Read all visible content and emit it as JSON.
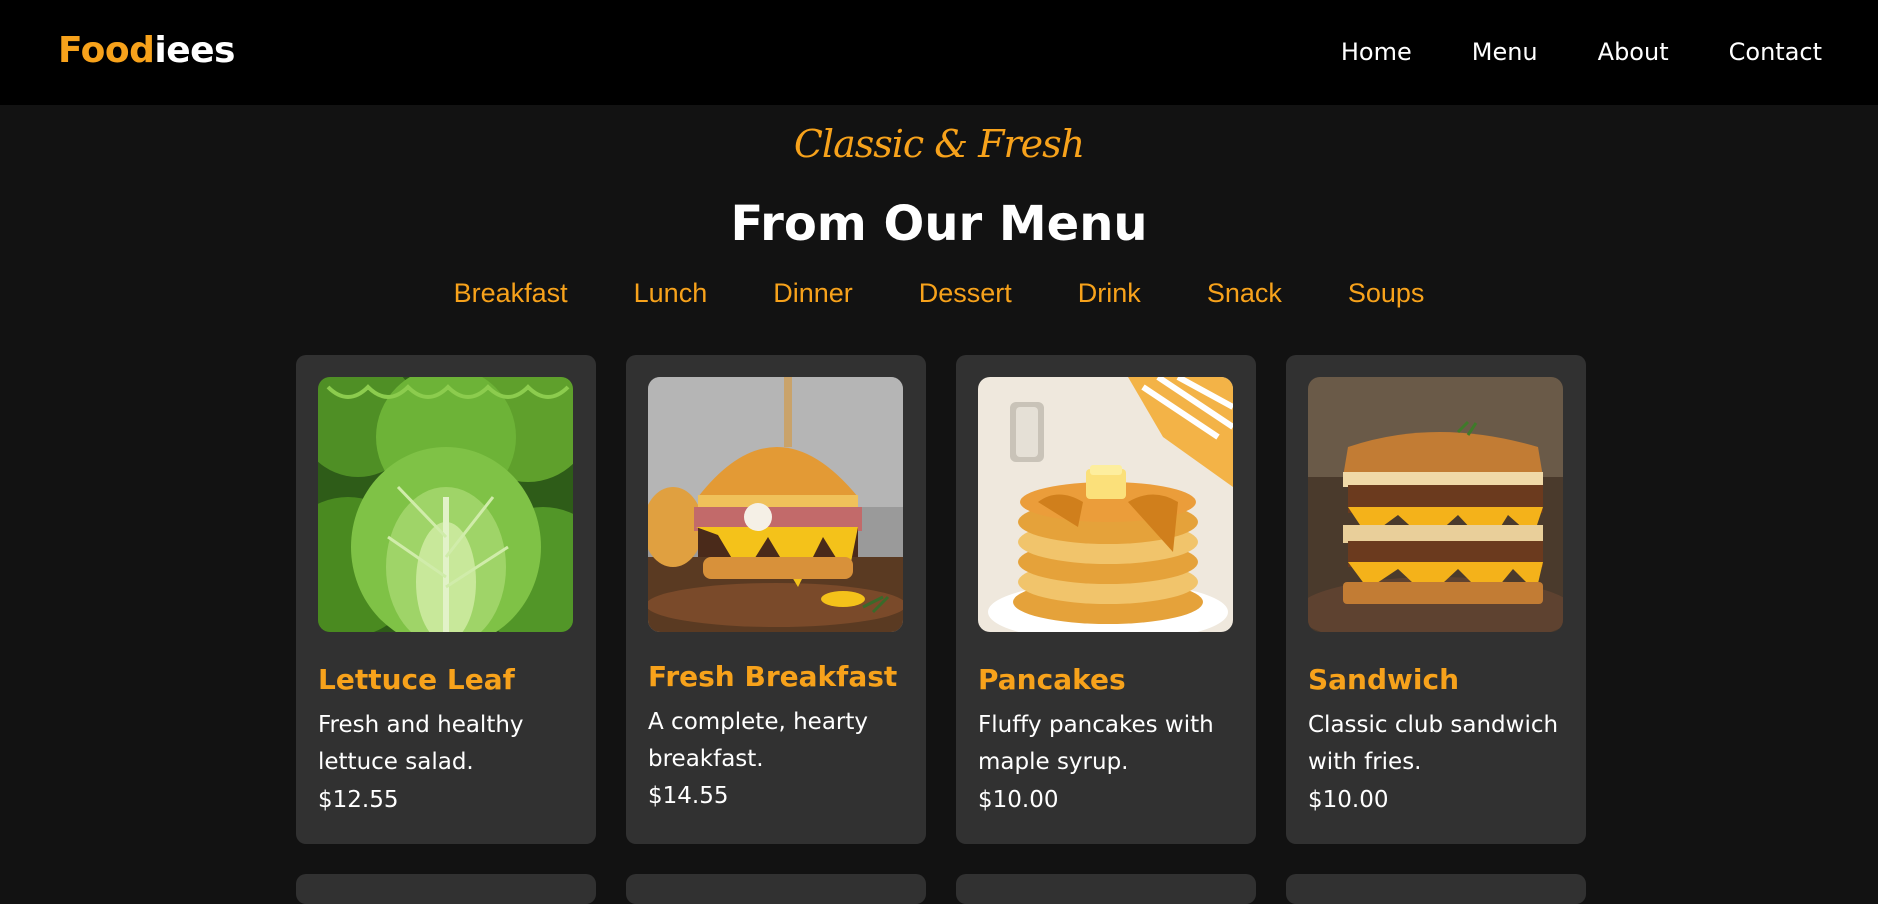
{
  "brand": {
    "part1": "Food",
    "part2": "iees"
  },
  "nav": [
    "Home",
    "Menu",
    "About",
    "Contact"
  ],
  "hero": {
    "subtitle": "Classic & Fresh",
    "title": "From Our Menu"
  },
  "categories": [
    "Breakfast",
    "Lunch",
    "Dinner",
    "Dessert",
    "Drink",
    "Snack",
    "Soups"
  ],
  "menu_items": [
    {
      "name": "Lettuce Leaf",
      "description": "Fresh and healthy lettuce salad.",
      "price": "$12.55",
      "image": "lettuce-image"
    },
    {
      "name": "Fresh Breakfast",
      "description": "A complete, hearty breakfast.",
      "price": "$14.55",
      "image": "burger-image"
    },
    {
      "name": "Pancakes",
      "description": "Fluffy pancakes with maple syrup.",
      "price": "$10.00",
      "image": "pancakes-image"
    },
    {
      "name": "Sandwich",
      "description": "Classic club sandwich with fries.",
      "price": "$10.00",
      "image": "sandwich-image"
    }
  ],
  "colors": {
    "accent": "#f7a21b",
    "background": "#121212",
    "card": "#313131",
    "navbar": "#000000"
  }
}
